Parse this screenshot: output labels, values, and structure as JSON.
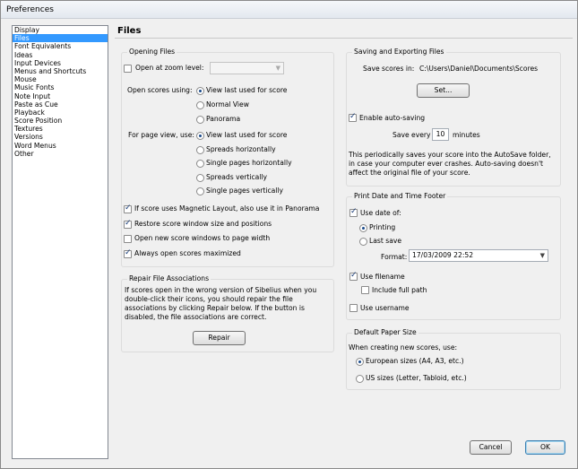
{
  "window": {
    "title": "Preferences"
  },
  "sidebar": {
    "items": [
      {
        "label": "Display",
        "selected": false
      },
      {
        "label": "Files",
        "selected": true
      },
      {
        "label": "Font Equivalents",
        "selected": false
      },
      {
        "label": "Ideas",
        "selected": false
      },
      {
        "label": "Input Devices",
        "selected": false
      },
      {
        "label": "Menus and Shortcuts",
        "selected": false
      },
      {
        "label": "Mouse",
        "selected": false
      },
      {
        "label": "Music Fonts",
        "selected": false
      },
      {
        "label": "Note Input",
        "selected": false
      },
      {
        "label": "Paste as Cue",
        "selected": false
      },
      {
        "label": "Playback",
        "selected": false
      },
      {
        "label": "Score Position",
        "selected": false
      },
      {
        "label": "Textures",
        "selected": false
      },
      {
        "label": "Versions",
        "selected": false
      },
      {
        "label": "Word Menus",
        "selected": false
      },
      {
        "label": "Other",
        "selected": false
      }
    ]
  },
  "heading": "Files",
  "opening_files": {
    "legend": "Opening Files",
    "open_at_zoom_label": "Open at zoom level:",
    "open_at_zoom_checked": false,
    "zoom_value": "",
    "open_scores_using_label": "Open scores using:",
    "open_scores_options": [
      {
        "label": "View last used for score",
        "checked": true
      },
      {
        "label": "Normal View",
        "checked": false
      },
      {
        "label": "Panorama",
        "checked": false
      }
    ],
    "page_view_label": "For page view, use:",
    "page_view_options": [
      {
        "label": "View last used for score",
        "checked": true
      },
      {
        "label": "Spreads horizontally",
        "checked": false
      },
      {
        "label": "Single pages horizontally",
        "checked": false
      },
      {
        "label": "Spreads vertically",
        "checked": false
      },
      {
        "label": "Single pages vertically",
        "checked": false
      }
    ],
    "checkboxes": [
      {
        "label": "If score uses Magnetic Layout, also use it in Panorama",
        "checked": true
      },
      {
        "label": "Restore score window size and positions",
        "checked": true
      },
      {
        "label": "Open new score windows to page width",
        "checked": false
      },
      {
        "label": "Always open scores maximized",
        "checked": true
      }
    ]
  },
  "repair": {
    "legend": "Repair File Associations",
    "text": "If scores open in the wrong version of Sibelius when you double-click their icons, you should repair the file associations by clicking Repair below. If the button is disabled, the file associations are correct.",
    "button": "Repair"
  },
  "saving": {
    "legend": "Saving and Exporting Files",
    "save_scores_label": "Save scores in:",
    "save_path": "C:\\Users\\Daniel\\Documents\\Scores",
    "set_button": "Set...",
    "auto_saving_label": "Enable auto-saving",
    "auto_saving_checked": true,
    "save_every_label": "Save every",
    "save_every_value": "10",
    "minutes_label": "minutes",
    "note": "This periodically saves your score into the AutoSave folder, in case your computer ever crashes. Auto-saving doesn't affect the original file of your score."
  },
  "print_footer": {
    "legend": "Print Date and Time Footer",
    "use_date_label": "Use date of:",
    "use_date_checked": true,
    "date_options": [
      {
        "label": "Printing",
        "checked": true
      },
      {
        "label": "Last save",
        "checked": false
      }
    ],
    "format_label": "Format:",
    "format_value": "17/03/2009 22:52",
    "use_filename_label": "Use filename",
    "use_filename_checked": true,
    "include_full_path_label": "Include full path",
    "include_full_path_checked": false,
    "use_username_label": "Use username",
    "use_username_checked": false
  },
  "paper": {
    "legend": "Default Paper Size",
    "when_label": "When creating new scores, use:",
    "options": [
      {
        "label": "European sizes (A4, A3, etc.)",
        "checked": true
      },
      {
        "label": "US sizes (Letter, Tabloid, etc.)",
        "checked": false
      }
    ]
  },
  "footer": {
    "cancel": "Cancel",
    "ok": "OK"
  }
}
